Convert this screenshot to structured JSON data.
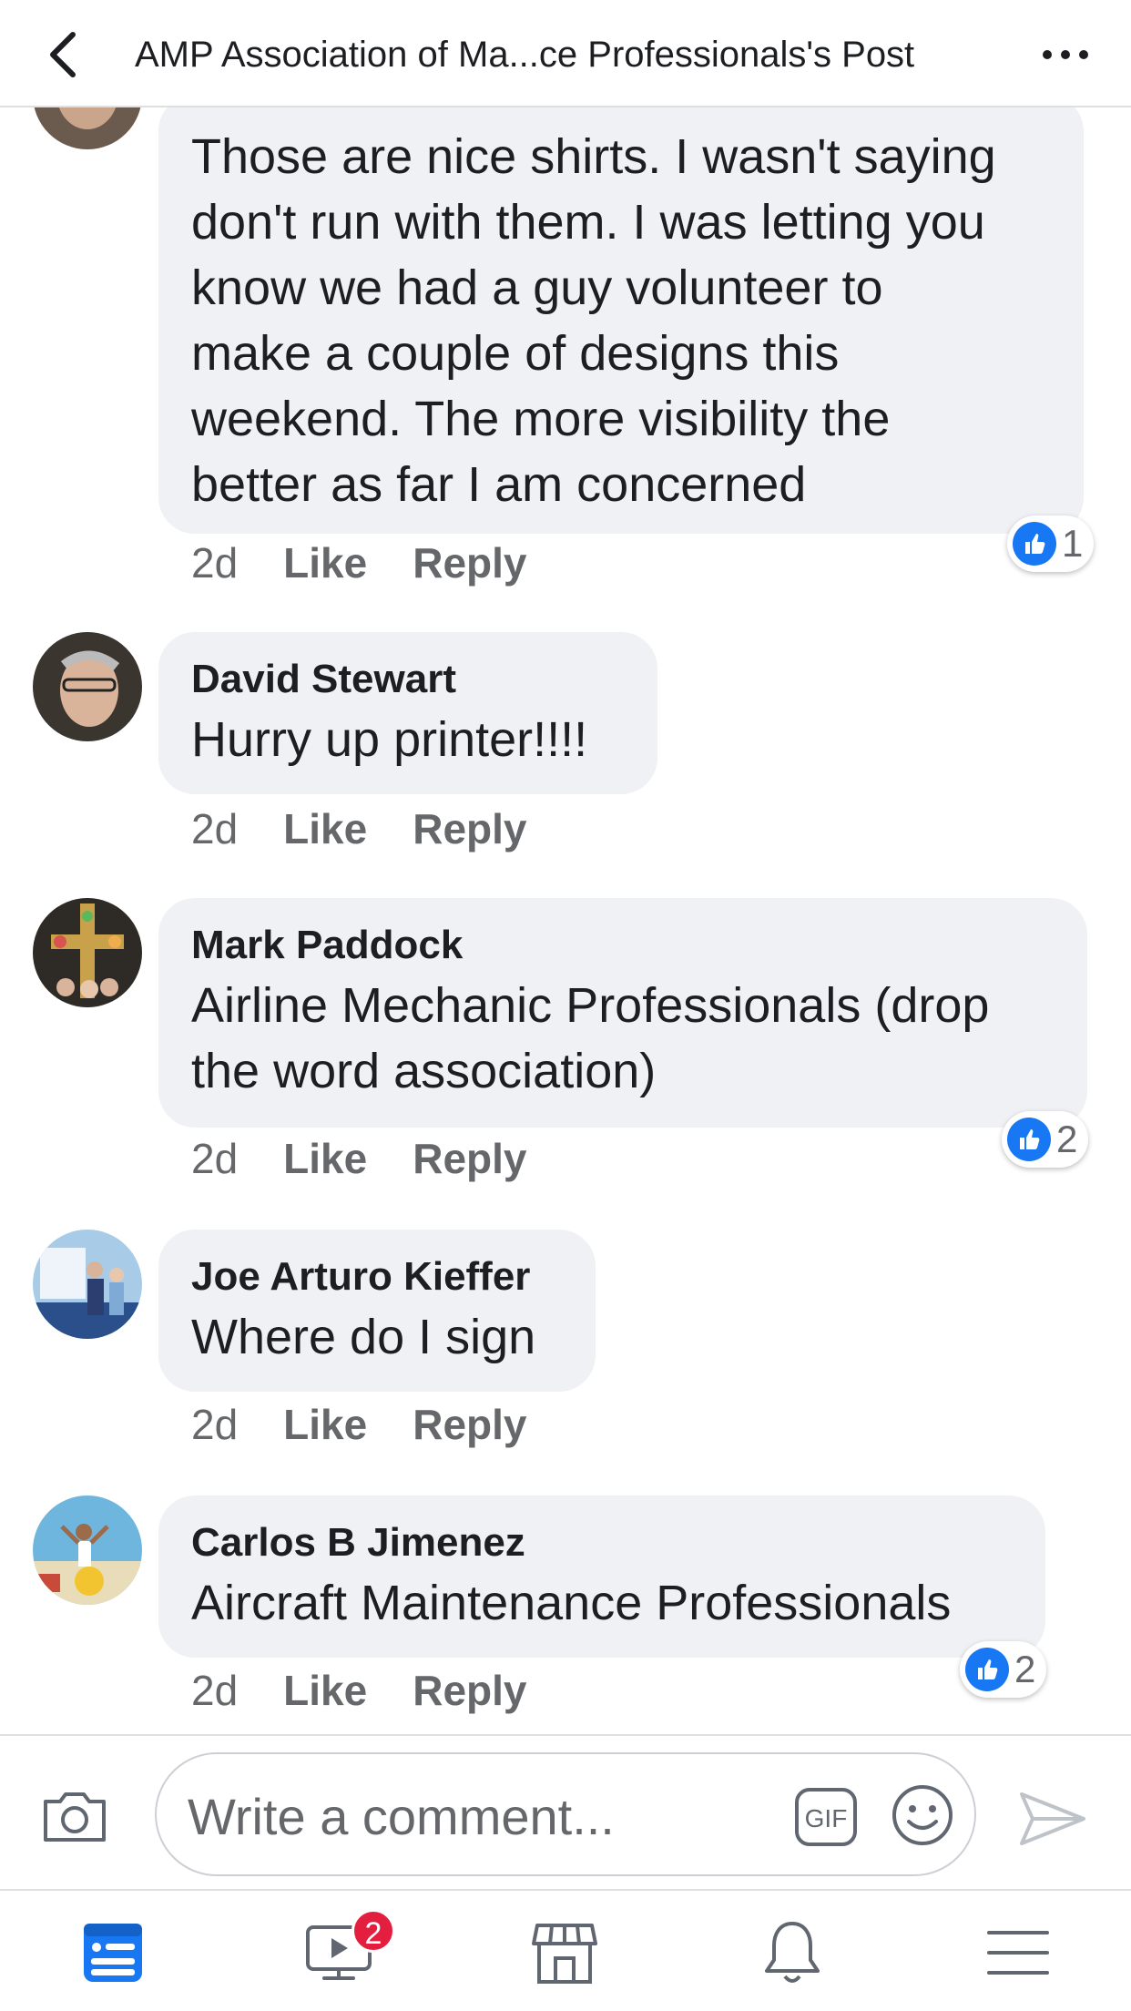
{
  "header": {
    "title": "AMP Association of Ma...ce Professionals's Post"
  },
  "comments": [
    {
      "author": "",
      "lines": [
        "Those are nice shirts. I wasn't saying",
        "don't run with them. I was letting you",
        "know we had a guy volunteer to",
        "make a couple of designs this",
        "weekend. The more visibility the",
        "better as far I am concerned"
      ],
      "time": "2d",
      "like": "Like",
      "reply": "Reply",
      "reactions": "1"
    },
    {
      "author": "David Stewart",
      "lines": [
        "Hurry up printer!!!!"
      ],
      "time": "2d",
      "like": "Like",
      "reply": "Reply",
      "reactions": ""
    },
    {
      "author": "Mark Paddock",
      "lines": [
        "Airline Mechanic Professionals (drop",
        "the word association)"
      ],
      "time": "2d",
      "like": "Like",
      "reply": "Reply",
      "reactions": "2"
    },
    {
      "author": "Joe Arturo Kieffer",
      "lines": [
        "Where do I sign"
      ],
      "time": "2d",
      "like": "Like",
      "reply": "Reply",
      "reactions": ""
    },
    {
      "author": "Carlos B Jimenez",
      "lines": [
        "Aircraft Maintenance Professionals"
      ],
      "time": "2d",
      "like": "Like",
      "reply": "Reply",
      "reactions": "2"
    }
  ],
  "composer": {
    "placeholder": "Write a comment...",
    "gif_label": "GIF"
  },
  "tabbar": {
    "watch_badge": "2",
    "items": [
      "news-feed",
      "watch",
      "marketplace",
      "notifications",
      "menu"
    ]
  },
  "colors": {
    "accent": "#1877f2",
    "bubble": "#f0f1f4",
    "muted": "#65676b",
    "badge": "#e41e3f"
  }
}
